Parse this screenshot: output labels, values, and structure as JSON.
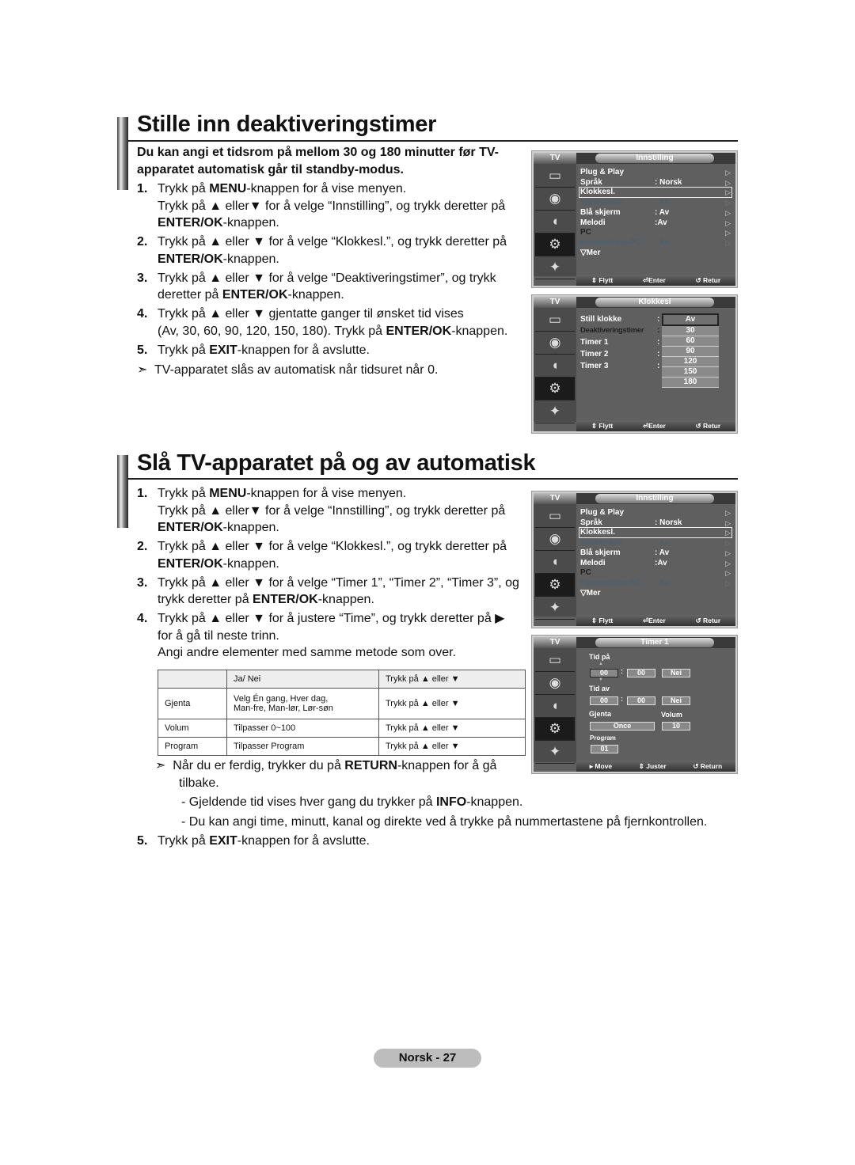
{
  "section1": {
    "title": "Stille inn deaktiveringstimer",
    "intro_line1": "Du kan angi et tidsrom på mellom 30 og 180 minutter før TV-",
    "intro_line2": "apparatet automatisk går til standby-modus.",
    "steps": [
      {
        "num": "1.",
        "lines": [
          {
            "pre": "Trykk på ",
            "bold": "MENU",
            "post": "-knappen for å vise menyen."
          },
          {
            "pre": "Trykk på ▲ eller▼ for å velge “Innstilling”, og trykk deretter på",
            "bold": "",
            "post": ""
          },
          {
            "pre": "",
            "bold": "ENTER/OK",
            "post": "-knappen."
          }
        ]
      },
      {
        "num": "2.",
        "lines": [
          {
            "pre": "Trykk på ▲ eller ▼ for å velge “Klokkesl.”, og trykk deretter på",
            "bold": "",
            "post": ""
          },
          {
            "pre": "",
            "bold": "ENTER/OK",
            "post": "-knappen."
          }
        ]
      },
      {
        "num": "3.",
        "lines": [
          {
            "pre": "Trykk på ▲ eller ▼ for å velge “Deaktiveringstimer”, og trykk",
            "bold": "",
            "post": ""
          },
          {
            "pre": "deretter på ",
            "bold": "ENTER/OK",
            "post": "-knappen."
          }
        ]
      },
      {
        "num": "4.",
        "lines": [
          {
            "pre": "Trykk på ▲ eller ▼ gjentatte ganger til ønsket tid vises",
            "bold": "",
            "post": ""
          },
          {
            "pre": "(Av, 30, 60, 90, 120, 150, 180). Trykk på ",
            "bold": "ENTER/OK",
            "post": "-knappen."
          }
        ]
      },
      {
        "num": "5.",
        "lines": [
          {
            "pre": "Trykk på ",
            "bold": "EXIT",
            "post": "-knappen for å avslutte."
          }
        ]
      }
    ],
    "note": "TV-apparatet slås av automatisk når tidsuret når 0."
  },
  "osd_common": {
    "tv_label": "TV",
    "footer_move": "Flytt",
    "footer_enter": "Enter",
    "footer_return": "Retur"
  },
  "osd_innstilling": {
    "title": "Innstilling",
    "items": [
      {
        "label": "Plug & Play",
        "value": "",
        "state": "normal"
      },
      {
        "label": "Språk",
        "value": ": Norsk",
        "state": "normal"
      },
      {
        "label": "Klokkesl.",
        "value": "",
        "state": "selected"
      },
      {
        "label": "Spillmodus",
        "value": ": Av",
        "state": "disabled"
      },
      {
        "label": "Blå skjerm",
        "value": ": Av",
        "state": "normal"
      },
      {
        "label": "Melodi",
        "value": ":Av",
        "state": "normal"
      },
      {
        "label": "PC",
        "value": "",
        "state": "dark"
      },
      {
        "label": "Hjemmekino-PC",
        "value": ": Av",
        "state": "disabled"
      },
      {
        "label": "▽Mer",
        "value": "",
        "state": "normal"
      }
    ]
  },
  "osd_klokkesl": {
    "title": "Klokkesl",
    "items": [
      {
        "label": "Still klokke",
        "state": "normal"
      },
      {
        "label": "Deaktiveringstimer",
        "state": "dark"
      },
      {
        "label": "Timer 1",
        "state": "normal"
      },
      {
        "label": "Timer 2",
        "state": "normal"
      },
      {
        "label": "Timer 3",
        "state": "normal"
      }
    ],
    "dropdown_options": [
      "Av",
      "30",
      "60",
      "90",
      "120",
      "150",
      "180"
    ],
    "dropdown_selected": "Av"
  },
  "section2": {
    "title": "Slå TV-apparatet på og av automatisk",
    "steps": [
      {
        "num": "1.",
        "lines": [
          {
            "pre": "Trykk på ",
            "bold": "MENU",
            "post": "-knappen for å vise menyen."
          },
          {
            "pre": "Trykk på ▲ eller▼ for å velge “Innstilling”, og trykk deretter på",
            "bold": "",
            "post": ""
          },
          {
            "pre": "",
            "bold": "ENTER/OK",
            "post": "-knappen."
          }
        ]
      },
      {
        "num": "2.",
        "lines": [
          {
            "pre": "Trykk på ▲ eller ▼ for å velge “Klokkesl.”, og trykk deretter på",
            "bold": "",
            "post": ""
          },
          {
            "pre": "",
            "bold": "ENTER/OK",
            "post": "-knappen."
          }
        ]
      },
      {
        "num": "3.",
        "lines": [
          {
            "pre": "Trykk på ▲ eller ▼ for å velge “Timer 1”, “Timer 2”, “Timer 3”, og",
            "bold": "",
            "post": ""
          },
          {
            "pre": "trykk deretter på ",
            "bold": "ENTER/OK",
            "post": "-knappen."
          }
        ]
      },
      {
        "num": "4.",
        "lines": [
          {
            "pre": "Trykk på ▲ eller ▼ for å justere “Time”, og trykk deretter på ▶",
            "bold": "",
            "post": ""
          },
          {
            "pre": "for å gå til neste trinn.",
            "bold": "",
            "post": ""
          },
          {
            "pre": "Angi andre elementer med samme metode som over.",
            "bold": "",
            "post": ""
          }
        ]
      }
    ],
    "table": [
      [
        "",
        "Ja/ Nei",
        "Trykk på ▲ eller ▼"
      ],
      [
        "Gjenta",
        "Velg Én gang, Hver dag,\nMan-fre, Man-lør, Lør-søn",
        "Trykk på ▲ eller ▼"
      ],
      [
        "Volum",
        "Tilpasser 0~100",
        "Trykk på ▲ eller ▼"
      ],
      [
        "Program",
        "Tilpasser Program",
        "Trykk på ▲ eller ▼"
      ]
    ],
    "note_pre": "Når du er ferdig, trykker du på ",
    "note_bold": "RETURN",
    "note_post": "-knappen for å gå",
    "note_line2": "tilbake.",
    "bullet1_pre": "- Gjeldende tid vises hver gang du trykker på ",
    "bullet1_bold": "INFO",
    "bullet1_post": "-knappen.",
    "bullet2": "- Du kan angi time, minutt, kanal og direkte ved å trykke på nummertastene på fjernkontrollen.",
    "step5_num": "5.",
    "step5_pre": "Trykk på ",
    "step5_bold": "EXIT",
    "step5_post": "-knappen for å avslutte."
  },
  "osd_timer1": {
    "title": "Timer 1",
    "tid_pa_label": "Tid på",
    "tid_pa_hour": "00",
    "tid_pa_min": "00",
    "tid_pa_toggle": "Nei",
    "tid_av_label": "Tid av",
    "tid_av_hour": "00",
    "tid_av_min": "00",
    "tid_av_toggle": "Nei",
    "gjenta_label": "Gjenta",
    "gjenta_value": "Once",
    "volum_label": "Volum",
    "volum_value": "10",
    "program_label": "Program",
    "program_value": "01",
    "footer_move": "Move",
    "footer_adjust": "Juster",
    "footer_return": "Return"
  },
  "footer": {
    "page_label": "Norsk - 27"
  }
}
